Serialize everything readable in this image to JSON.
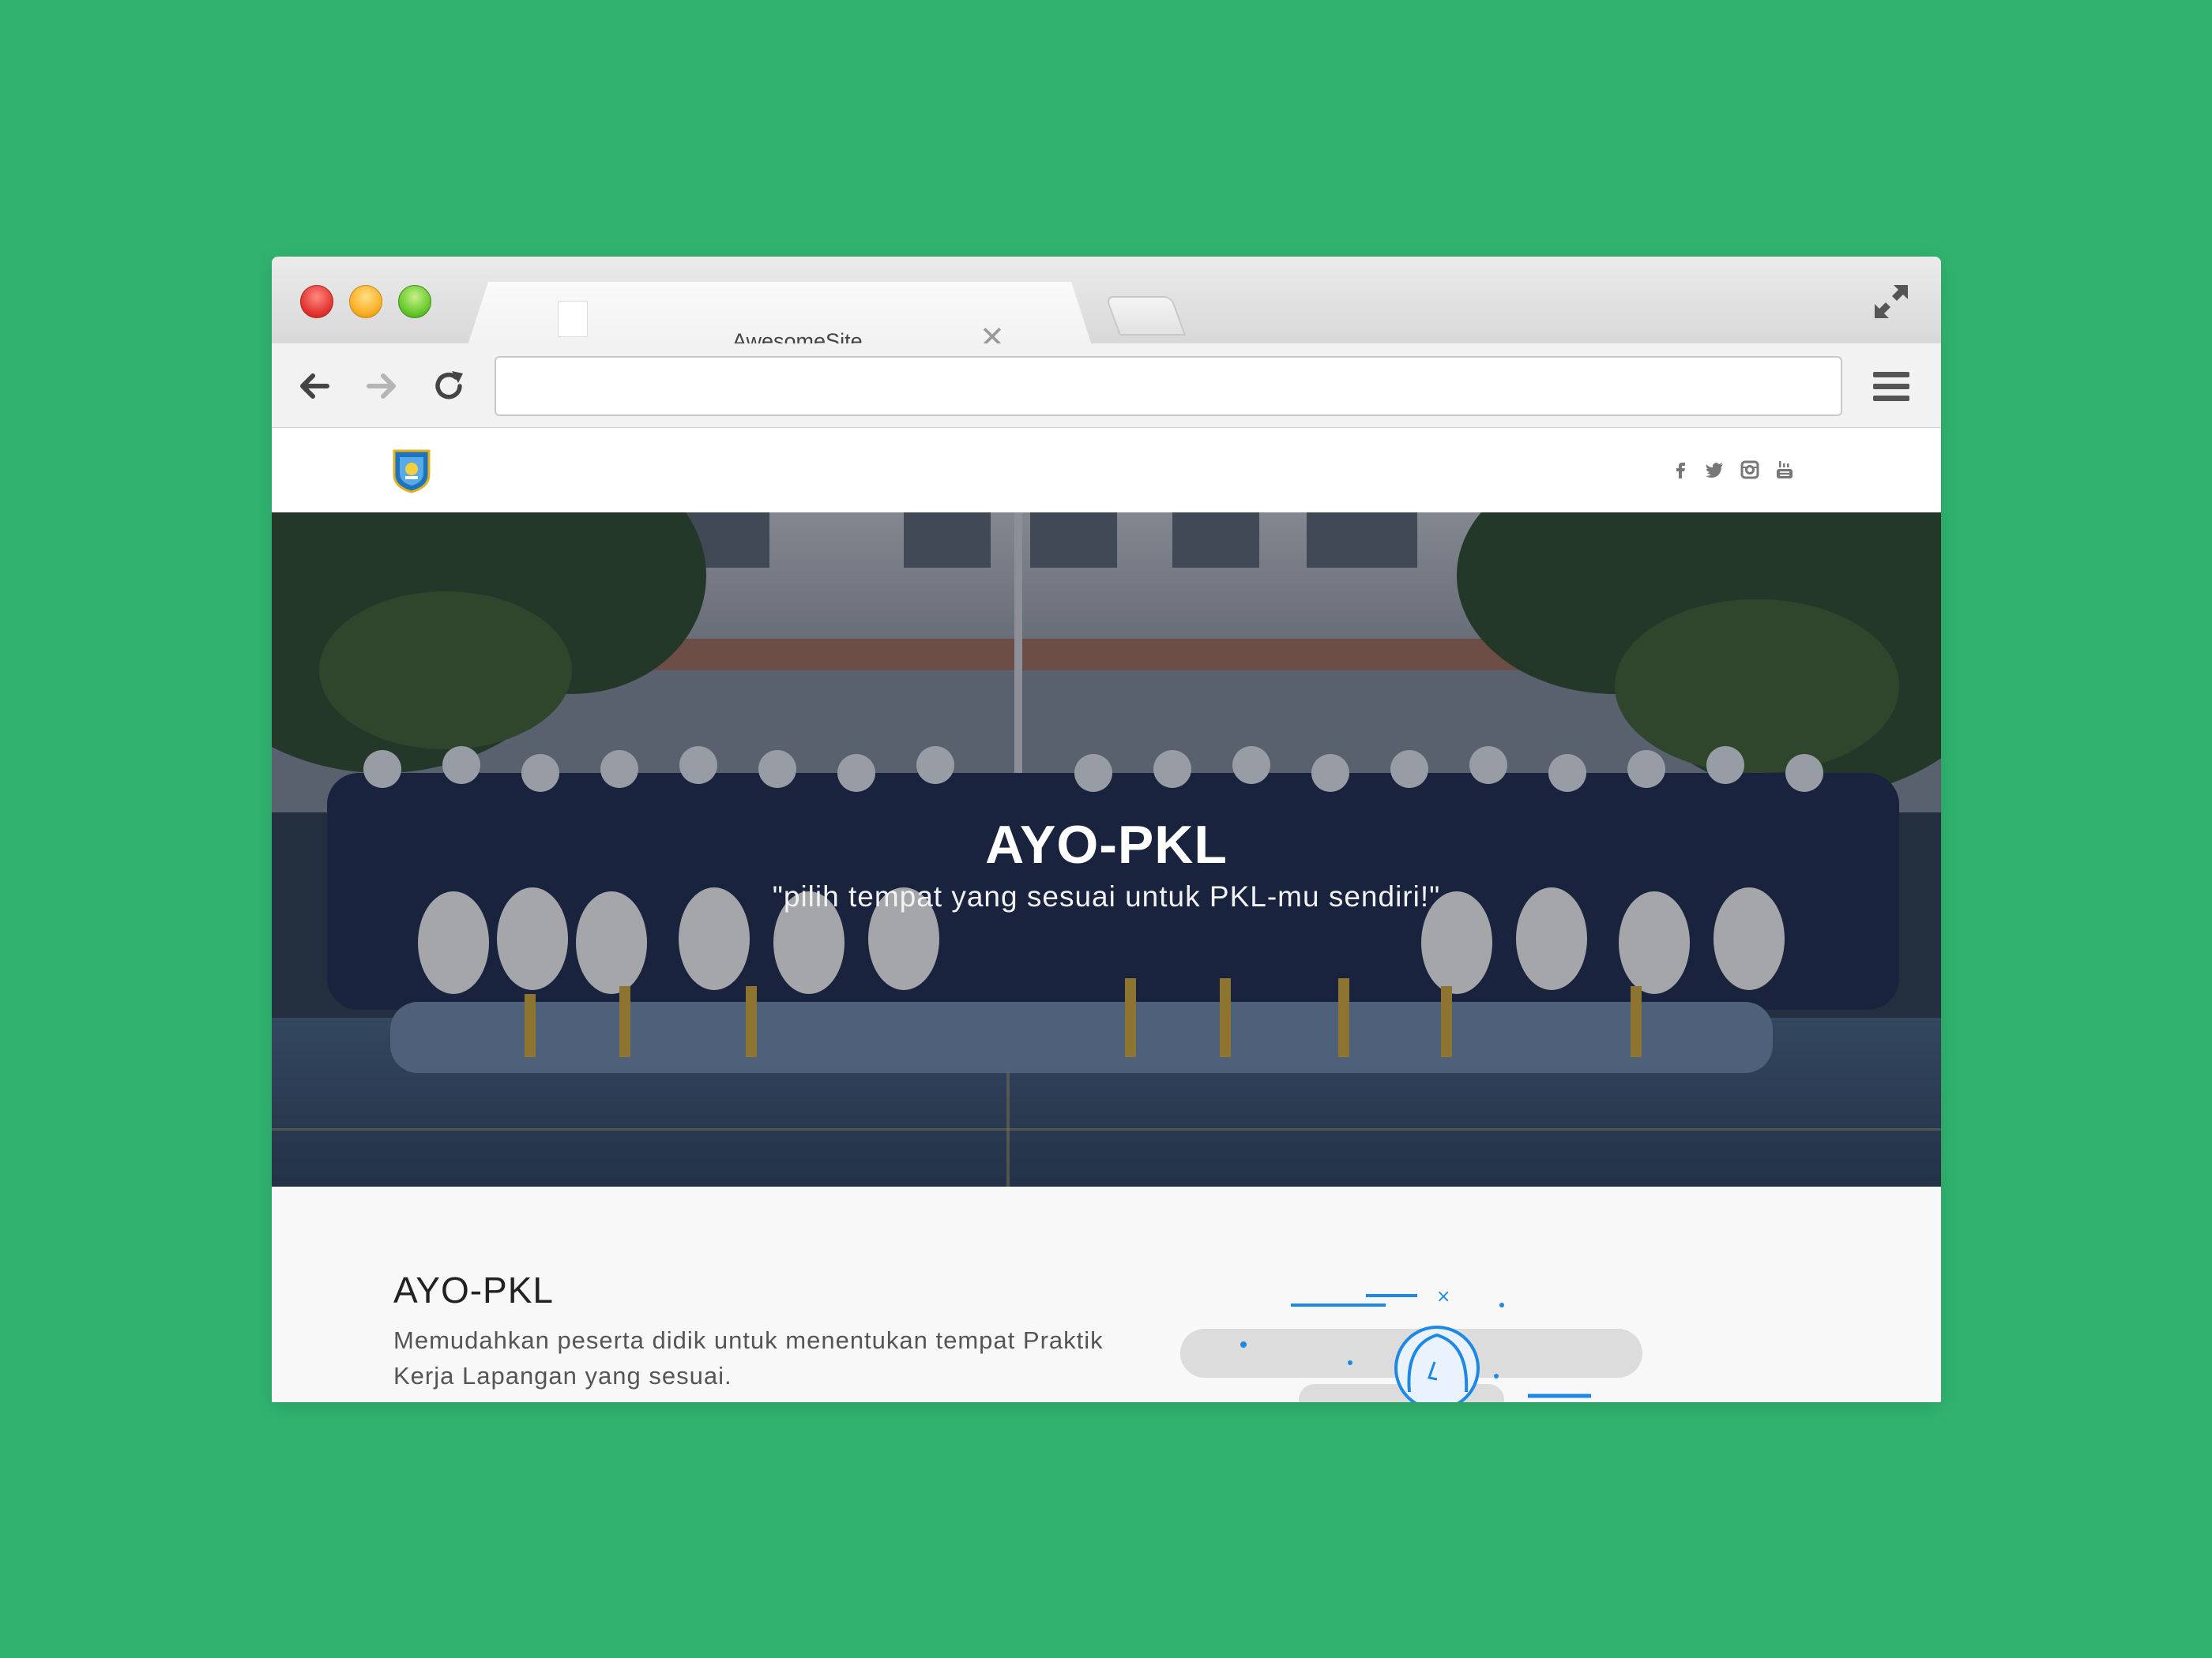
{
  "browser": {
    "tab_title": "AwesomeSite",
    "tab_close": "✕",
    "url": ""
  },
  "site": {
    "social": [
      "facebook-icon",
      "twitter-icon",
      "instagram-icon",
      "youtube-icon"
    ]
  },
  "hero": {
    "title": "AYO-PKL",
    "subtitle": "\"pilih tempat yang sesuai untuk PKL-mu sendiri!\""
  },
  "about": {
    "title": "AYO-PKL",
    "text": "Memudahkan peserta didik untuk menentukan tempat Praktik Kerja Lapangan yang sesuai."
  },
  "colors": {
    "background": "#31b36f",
    "accent": "#1e88e5"
  }
}
